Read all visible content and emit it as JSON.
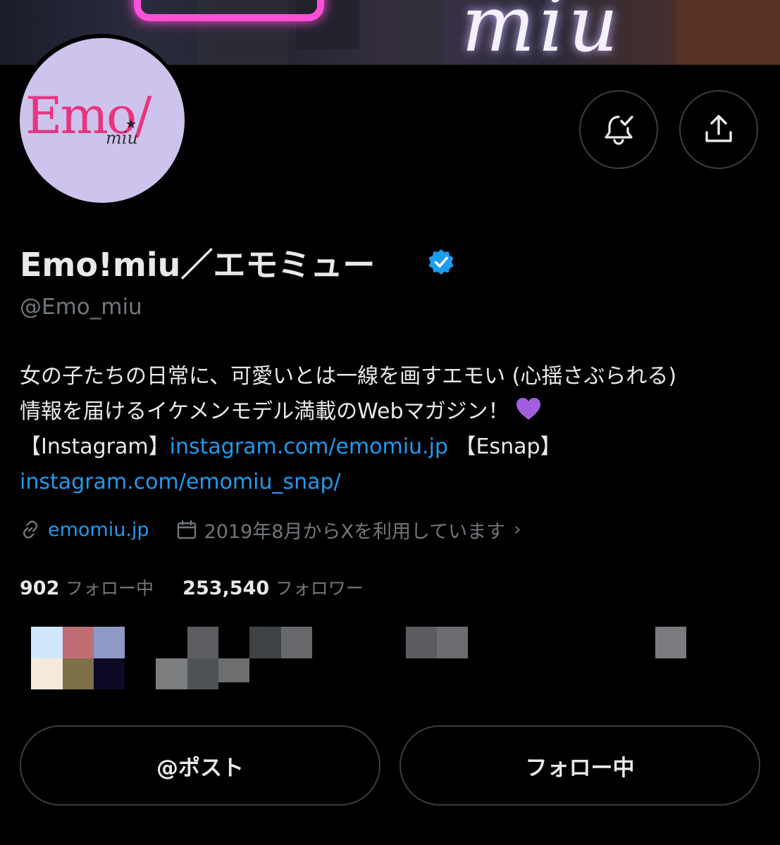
{
  "profile": {
    "display_name": "Emo!miu／エモミュー",
    "handle": "@Emo_miu",
    "logo_text": "Emo/",
    "logo_sub": "miu",
    "bio_line1": "女の子たちの日常に、可愛いとは一線を画すエモい (心揺さぶられる)",
    "bio_line2": "情報を届けるイケメンモデル満載のWebマガジン！",
    "bio_ig_label": "【Instagram】",
    "bio_ig_link": "instagram.com/emomiu.jp",
    "bio_esnap_label": " 【Esnap】",
    "bio_esnap_link": "instagram.com/emomiu_snap/",
    "website": "emomiu.jp",
    "joined": "2019年8月からXを利用しています",
    "joined_chevron": "›"
  },
  "stats": {
    "following_count": "902",
    "following_label": "フォロー中",
    "followers_count": "253,540",
    "followers_label": "フォロワー"
  },
  "buttons": {
    "post_mention": "@ポスト",
    "follow_state": "フォロー中"
  },
  "icons": {
    "notification": "bell-check-icon",
    "share": "share-upload-icon",
    "verified": "verified-badge-icon",
    "link": "link-icon",
    "calendar": "calendar-icon",
    "heart": "purple-heart-icon"
  },
  "colors": {
    "link": "#1d9bf0",
    "muted": "#71767b",
    "logo_pink": "#e9347f",
    "avatar_bg": "#cec3ec"
  }
}
